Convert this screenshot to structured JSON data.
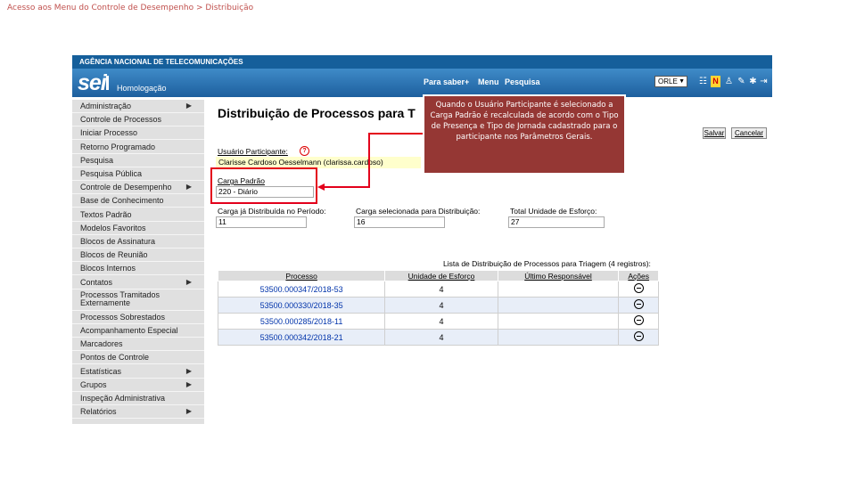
{
  "slide_title": "Acesso aos Menu do Controle de Desempenho > Distribuição",
  "header": {
    "agency": "AGÊNCIA NACIONAL DE TELECOMUNICAÇÕES",
    "logo": "sei",
    "environment": "Homologação",
    "nav": [
      "Para saber+",
      "Menu",
      "Pesquisa"
    ],
    "orgao_selected": "ORLE",
    "icons": [
      "grid-icon",
      "n-icon",
      "user-icon",
      "tools-icon",
      "gear-icon",
      "logout-icon"
    ]
  },
  "sidebar": {
    "items": [
      {
        "label": "Administração",
        "arrow": true
      },
      {
        "label": "Controle de Processos",
        "arrow": false
      },
      {
        "label": "Iniciar Processo",
        "arrow": false
      },
      {
        "label": "Retorno Programado",
        "arrow": false
      },
      {
        "label": "Pesquisa",
        "arrow": false
      },
      {
        "label": "Pesquisa Pública",
        "arrow": false
      },
      {
        "label": "Controle de Desempenho",
        "arrow": true
      },
      {
        "label": "Base de Conhecimento",
        "arrow": false
      },
      {
        "label": "Textos Padrão",
        "arrow": false
      },
      {
        "label": "Modelos Favoritos",
        "arrow": false
      },
      {
        "label": "Blocos de Assinatura",
        "arrow": false
      },
      {
        "label": "Blocos de Reunião",
        "arrow": false
      },
      {
        "label": "Blocos Internos",
        "arrow": false
      },
      {
        "label": "Contatos",
        "arrow": true
      },
      {
        "label": "Processos Tramitados Externamente",
        "arrow": false
      },
      {
        "label": "Processos Sobrestados",
        "arrow": false
      },
      {
        "label": "Acompanhamento Especial",
        "arrow": false
      },
      {
        "label": "Marcadores",
        "arrow": false
      },
      {
        "label": "Pontos de Controle",
        "arrow": false
      },
      {
        "label": "Estatísticas",
        "arrow": true
      },
      {
        "label": "Grupos",
        "arrow": true
      },
      {
        "label": "Inspeção Administrativa",
        "arrow": false
      },
      {
        "label": "Relatórios",
        "arrow": true
      }
    ]
  },
  "main": {
    "title": "Distribuição de Processos para T",
    "buttons": {
      "save": "Salvar",
      "cancel": "Cancelar"
    },
    "participant_label": "Usuário Participante:",
    "help_glyph": "?",
    "participant_value": "Clarisse Cardoso Oesselmann (clarissa.cardoso)",
    "load_label": "Carga Padrão",
    "load_value": "220 - Diário",
    "distributed_label": "Carga já Distribuída no Período:",
    "distributed_value": "11",
    "selected_label": "Carga selecionada para Distribuição:",
    "selected_value": "16",
    "total_label": "Total Unidade de Esforço:",
    "total_value": "27",
    "table_caption": "Lista de Distribuição de Processos para Triagem (4 registros):",
    "columns": [
      "Processo",
      "Unidade de Esforço",
      "Último Responsável",
      "Ações"
    ],
    "rows": [
      {
        "processo": "53500.000347/2018-53",
        "esforco": "4",
        "responsavel": ""
      },
      {
        "processo": "53500.000330/2018-35",
        "esforco": "4",
        "responsavel": ""
      },
      {
        "processo": "53500.000285/2018-11",
        "esforco": "4",
        "responsavel": ""
      },
      {
        "processo": "53500.000342/2018-21",
        "esforco": "4",
        "responsavel": ""
      }
    ]
  },
  "callout": {
    "text": "Quando o Usuário Participante é selecionado a Carga Padrão é recalculada de acordo com o Tipo de Presença e Tipo de Jornada cadastrado para o participante nos Parâmetros Gerais."
  },
  "colors": {
    "header_blue": "#1d5f9e",
    "callout_bg": "#953734",
    "highlight_red": "#e3001b",
    "link_blue": "#0033aa"
  }
}
